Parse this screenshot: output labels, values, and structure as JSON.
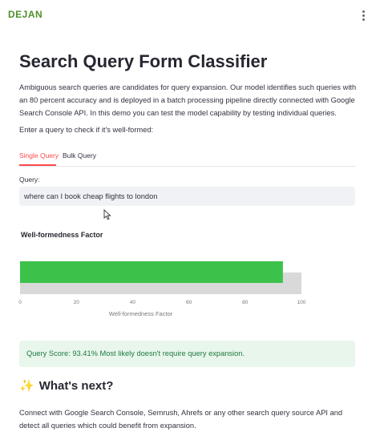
{
  "header": {
    "logo_text": "DEJAN",
    "menu_icon": "kebab-menu-icon"
  },
  "main": {
    "title": "Search Query Form Classifier",
    "description": "Ambiguous search queries are candidates for query expansion. Our model identifies such queries with an 80 percent accuracy and is deployed in a batch processing pipeline directly connected with Google Search Console API. In this demo you can test the model capability by testing individual queries.",
    "prompt": "Enter a query to check if it's well-formed:",
    "tabs": [
      {
        "label": "Single Query",
        "active": true
      },
      {
        "label": "Bulk Query",
        "active": false
      }
    ],
    "query_label": "Query:",
    "query_value": "where can I book cheap flights to london",
    "chart_heading": "Well-formedness Factor",
    "result_text": "Query Score: 93.41% Most likely doesn't require query expansion.",
    "next_heading": "What's next?",
    "next_icon": "sparkles-icon",
    "next_text": "Connect with Google Search Console, Semrush, Ahrefs or any other search query source API and detect all queries which could benefit from expansion."
  },
  "colors": {
    "accent": "#ff4b4b",
    "bar_fill": "#3cc24a",
    "bar_track": "#d9d9d9",
    "success_bg": "#e8f6ec",
    "success_text": "#1f7a3d",
    "logo": "#4f8f2b"
  },
  "chart_data": {
    "type": "bar",
    "orientation": "horizontal",
    "title": "Well-formedness Factor",
    "xlabel": "Well-formedness Factor",
    "xlim": [
      0,
      100
    ],
    "ticks": [
      0,
      20,
      40,
      60,
      80,
      100
    ],
    "track_value": 100,
    "values": [
      93.41
    ]
  }
}
